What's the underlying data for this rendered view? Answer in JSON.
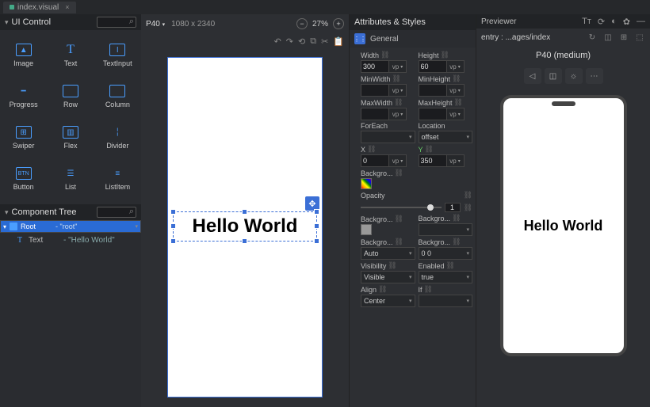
{
  "tab": {
    "name": "index.visual",
    "close": "×"
  },
  "ui_control": {
    "title": "UI Control",
    "items": [
      {
        "label": "Image"
      },
      {
        "label": "Text"
      },
      {
        "label": "TextInput"
      },
      {
        "label": "Progress"
      },
      {
        "label": "Row"
      },
      {
        "label": "Column"
      },
      {
        "label": "Swiper"
      },
      {
        "label": "Flex"
      },
      {
        "label": "Divider"
      },
      {
        "label": "Button"
      },
      {
        "label": "List"
      },
      {
        "label": "ListItem"
      }
    ]
  },
  "component_tree": {
    "title": "Component Tree",
    "root": {
      "name": "Root",
      "value": "- \"root\""
    },
    "text": {
      "name": "Text",
      "value": "- \"Hello World\""
    }
  },
  "canvas": {
    "device": "P40",
    "dims": "1080 x 2340",
    "zoom": "27%",
    "selected_text": "Hello World"
  },
  "attrs": {
    "header": "Attributes & Styles",
    "section": "General",
    "width": {
      "label": "Width",
      "val": "300",
      "unit": "vp"
    },
    "height": {
      "label": "Height",
      "val": "60",
      "unit": "vp"
    },
    "minwidth": {
      "label": "MinWidth",
      "val": "",
      "unit": "vp"
    },
    "minheight": {
      "label": "MinHeight",
      "val": "",
      "unit": "vp"
    },
    "maxwidth": {
      "label": "MaxWidth",
      "val": "",
      "unit": "vp"
    },
    "maxheight": {
      "label": "MaxHeight",
      "val": "",
      "unit": "vp"
    },
    "foreach": {
      "label": "ForEach"
    },
    "location": {
      "label": "Location",
      "val": "offset"
    },
    "x": {
      "label": "X",
      "val": "0",
      "unit": "vp"
    },
    "y": {
      "label": "Y",
      "val": "350",
      "unit": "vp"
    },
    "bgcolor": {
      "label": "Backgro..."
    },
    "opacity": {
      "label": "Opacity",
      "val": "1"
    },
    "bgimg": {
      "label": "Backgro..."
    },
    "bgimg2": {
      "label": "Backgro..."
    },
    "bgsize": {
      "label": "Backgro...",
      "val": "Auto"
    },
    "bgpos": {
      "label": "Backgro...",
      "val": "0 0"
    },
    "visibility": {
      "label": "Visibility",
      "val": "Visible"
    },
    "enabled": {
      "label": "Enabled",
      "val": "true"
    },
    "align": {
      "label": "Align",
      "val": "Center"
    },
    "if": {
      "label": "If"
    }
  },
  "previewer": {
    "title": "Previewer",
    "entry": "entry : ...ages/index",
    "device": "P40 (medium)",
    "text": "Hello World"
  }
}
